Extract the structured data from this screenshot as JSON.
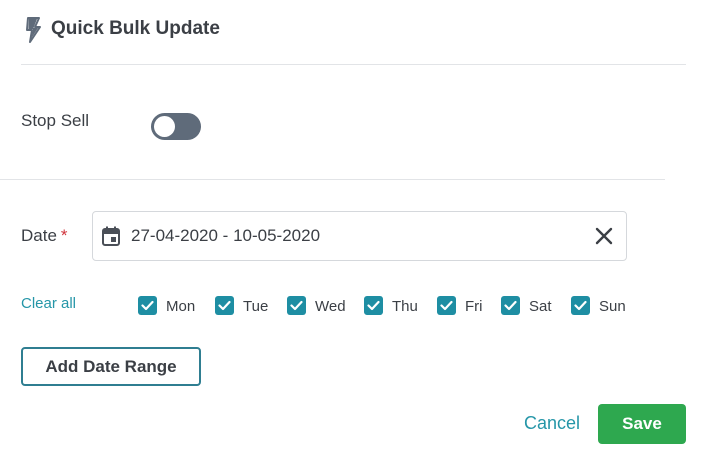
{
  "header": {
    "title": "Quick Bulk Update",
    "icon": "lightning-bolt-icon"
  },
  "stop_sell": {
    "label": "Stop Sell",
    "enabled": false
  },
  "date": {
    "label": "Date",
    "required_marker": "*",
    "value": "27-04-2020 - 10-05-2020",
    "calendar_icon": "calendar-icon",
    "clear_icon": "close-icon"
  },
  "days": {
    "clear_all_label": "Clear all",
    "items": [
      {
        "label": "Mon",
        "checked": true
      },
      {
        "label": "Tue",
        "checked": true
      },
      {
        "label": "Wed",
        "checked": true
      },
      {
        "label": "Thu",
        "checked": true
      },
      {
        "label": "Fri",
        "checked": true
      },
      {
        "label": "Sat",
        "checked": true
      },
      {
        "label": "Sun",
        "checked": true
      }
    ]
  },
  "actions": {
    "add_date_range_label": "Add Date Range",
    "cancel_label": "Cancel",
    "save_label": "Save"
  },
  "colors": {
    "accent": "#2596a8",
    "checkbox": "#1e8ea3",
    "save": "#2ea84f",
    "toggle_off": "#5f6b7a",
    "required": "#d0343c"
  }
}
